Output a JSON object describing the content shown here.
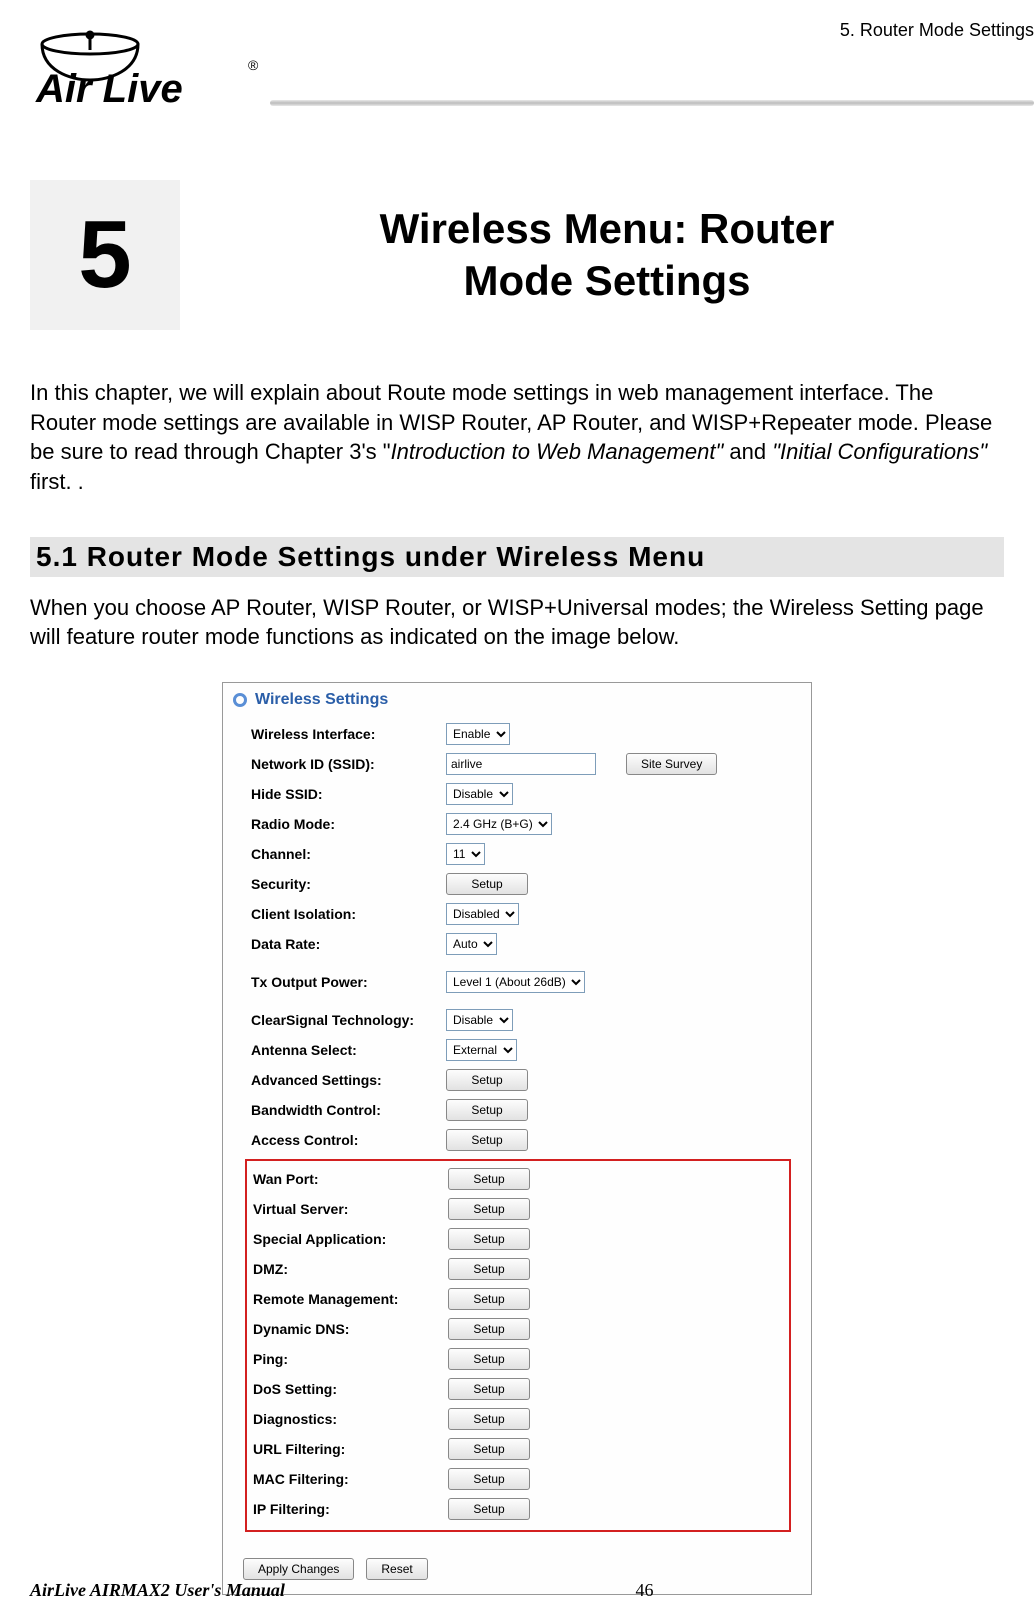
{
  "header": {
    "breadcrumb": "5.  Router Mode Settings",
    "logo_text": "Air Live",
    "logo_reg": "®"
  },
  "chapter": {
    "number": "5",
    "title_line1": "Wireless Menu: Router",
    "title_line2": "Mode Settings"
  },
  "intro": {
    "part1": "In this chapter, we will explain about Route mode settings in web management interface.  The Router mode settings are available in WISP Router, AP Router, and WISP+Repeater mode.   Please be sure to read through Chapter 3's \"",
    "ital1": "Introduction to Web Management\"",
    "part2": " and ",
    "ital2": "\"Initial Configurations\"",
    "part3": " first.   ."
  },
  "section": {
    "heading": "5.1 Router Mode Settings under Wireless Menu",
    "para": "When you choose AP Router, WISP Router, or WISP+Universal modes; the Wireless Setting page will feature router mode functions as indicated on the image below."
  },
  "panel": {
    "title": "Wireless Settings",
    "rows": {
      "wireless_interface": {
        "label": "Wireless Interface:",
        "value": "Enable"
      },
      "ssid": {
        "label": "Network ID (SSID):",
        "value": "airlive",
        "button": "Site Survey"
      },
      "hide_ssid": {
        "label": "Hide SSID:",
        "value": "Disable"
      },
      "radio_mode": {
        "label": "Radio Mode:",
        "value": "2.4 GHz (B+G)"
      },
      "channel": {
        "label": "Channel:",
        "value": "11"
      },
      "security": {
        "label": "Security:",
        "button": "Setup"
      },
      "client_isolation": {
        "label": "Client Isolation:",
        "value": "Disabled"
      },
      "data_rate": {
        "label": "Data Rate:",
        "value": "Auto"
      },
      "tx_power": {
        "label": "Tx Output Power:",
        "value": "Level 1 (About 26dB)"
      },
      "clearsignal": {
        "label": "ClearSignal Technology:",
        "value": "Disable"
      },
      "antenna": {
        "label": "Antenna Select:",
        "value": "External"
      },
      "advanced": {
        "label": "Advanced Settings:",
        "button": "Setup"
      },
      "bandwidth": {
        "label": "Bandwidth Control:",
        "button": "Setup"
      },
      "access": {
        "label": "Access Control:",
        "button": "Setup"
      }
    },
    "highlight": [
      {
        "label": "Wan Port:",
        "button": "Setup"
      },
      {
        "label": "Virtual Server:",
        "button": "Setup"
      },
      {
        "label": "Special Application:",
        "button": "Setup"
      },
      {
        "label": "DMZ:",
        "button": "Setup"
      },
      {
        "label": "Remote Management:",
        "button": "Setup"
      },
      {
        "label": "Dynamic DNS:",
        "button": "Setup"
      },
      {
        "label": "Ping:",
        "button": "Setup"
      },
      {
        "label": "DoS Setting:",
        "button": "Setup"
      },
      {
        "label": "Diagnostics:",
        "button": "Setup"
      },
      {
        "label": "URL Filtering:",
        "button": "Setup"
      },
      {
        "label": "MAC Filtering:",
        "button": "Setup"
      },
      {
        "label": "IP Filtering:",
        "button": "Setup"
      }
    ],
    "actions": {
      "apply": "Apply Changes",
      "reset": "Reset"
    }
  },
  "footer": {
    "manual": "AirLive AIRMAX2 User's Manual",
    "page": "46"
  }
}
